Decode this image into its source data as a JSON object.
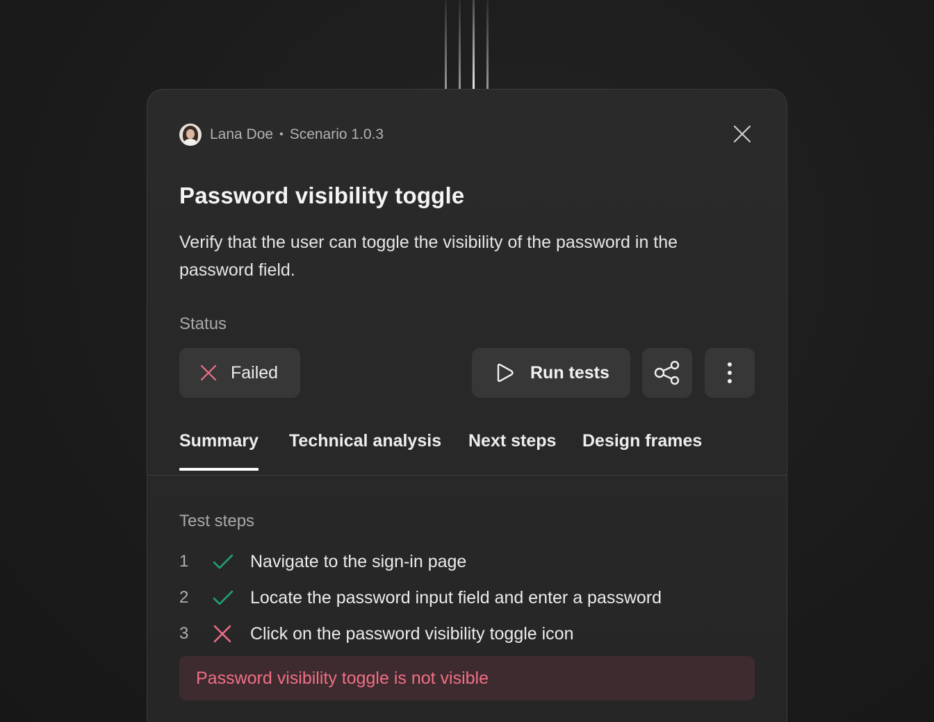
{
  "header": {
    "author": "Lana Doe",
    "separator": "•",
    "scenario": "Scenario 1.0.3"
  },
  "title": "Password visibility toggle",
  "description": "Verify that the user can toggle the visibility of the password in the password field.",
  "status": {
    "label": "Status",
    "value": "Failed"
  },
  "actions": {
    "run_label": "Run tests",
    "share_icon": "share-icon",
    "more_icon": "more-vertical-icon"
  },
  "tabs": [
    {
      "label": "Summary",
      "active": true
    },
    {
      "label": "Technical analysis",
      "active": false
    },
    {
      "label": "Next steps",
      "active": false
    },
    {
      "label": "Design frames",
      "active": false
    }
  ],
  "test_steps": {
    "label": "Test steps",
    "items": [
      {
        "number": "1",
        "result": "pass",
        "text": "Navigate to the sign-in page"
      },
      {
        "number": "2",
        "result": "pass",
        "text": "Locate the password input field and enter a password"
      },
      {
        "number": "3",
        "result": "fail",
        "text": "Click on the password visibility toggle icon"
      }
    ],
    "error": "Password visibility toggle is not visible"
  },
  "colors": {
    "pass": "#1fa37a",
    "fail": "#ef6f85",
    "error_bg": "#3e2b2f",
    "card_bg": "#282828"
  }
}
